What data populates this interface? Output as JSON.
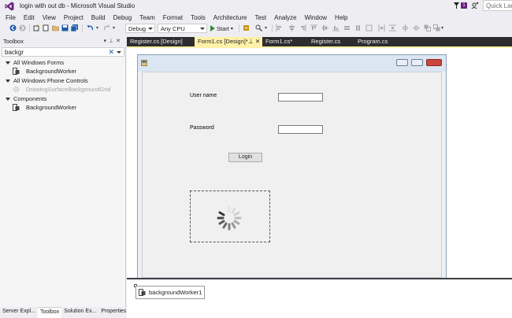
{
  "window": {
    "title": "login with out db - Microsoft Visual Studio",
    "notification_count": "1",
    "quick_launch_placeholder": "Quick Launch"
  },
  "menu": [
    "File",
    "Edit",
    "View",
    "Project",
    "Build",
    "Debug",
    "Team",
    "Format",
    "Tools",
    "Architecture",
    "Test",
    "Analyze",
    "Window",
    "Help"
  ],
  "toolbar": {
    "configuration": "Debug",
    "platform": "Any CPU",
    "start_label": "Start"
  },
  "toolbox": {
    "title": "Toolbox",
    "search_value": "backgr",
    "groups": [
      {
        "label": "All Windows Forms",
        "items": [
          {
            "label": "BackgroundWorker",
            "disabled": false
          }
        ]
      },
      {
        "label": "All Windows Phone Controls",
        "items": [
          {
            "label": "DrawingSurfaceBackgroundGrid",
            "disabled": true
          }
        ]
      },
      {
        "label": "Components",
        "items": [
          {
            "label": "BackgroundWorker",
            "disabled": false
          }
        ]
      }
    ]
  },
  "bottom_tabs": [
    "Server Expl...",
    "Toolbox",
    "Solution Ex...",
    "Properties"
  ],
  "doc_tabs": [
    "Register.cs [Design]",
    "Form1.cs [Design]*",
    "Form1.cs*",
    "Register.cs",
    "Program.cs"
  ],
  "form": {
    "username_label": "User name",
    "password_label": "Password",
    "login_label": "Login"
  },
  "tray": {
    "component": "backgroundWorker1"
  },
  "colors": {
    "active_tab": "#fff1a8",
    "tab_strip": "#2d2d30",
    "vs_purple": "#68217a",
    "start_green": "#388a34"
  }
}
